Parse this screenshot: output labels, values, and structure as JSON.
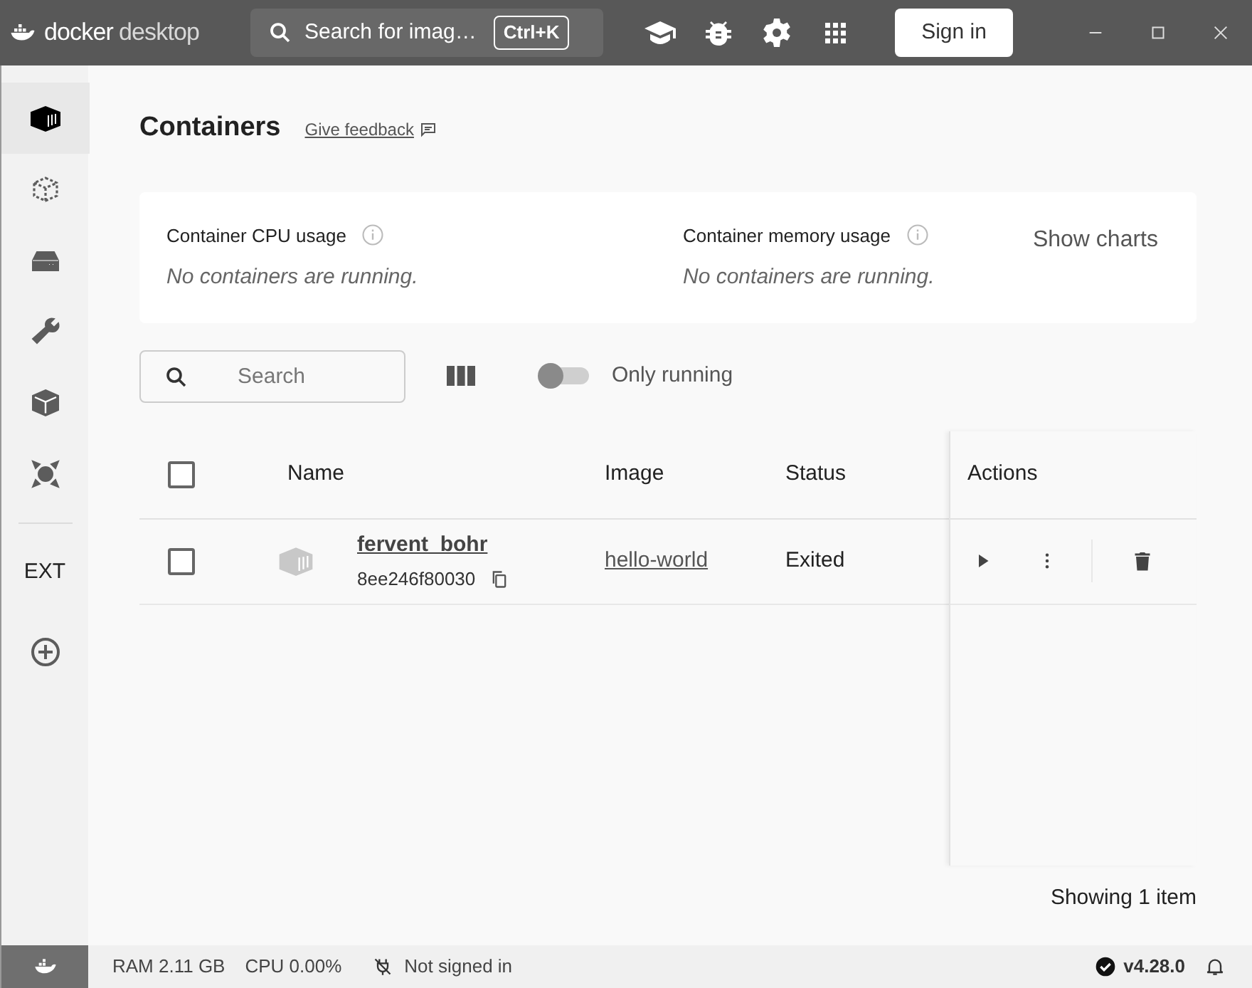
{
  "titlebar": {
    "logo_word": "docker",
    "logo_suffix": "desktop",
    "search_placeholder": "Search for imag…",
    "shortcut": "Ctrl+K",
    "sign_in": "Sign in"
  },
  "sidebar": {
    "items": [
      {
        "kind": "containers",
        "selected": true
      },
      {
        "kind": "images",
        "selected": false
      },
      {
        "kind": "volumes",
        "selected": false
      },
      {
        "kind": "builds",
        "selected": false
      },
      {
        "kind": "devenv",
        "selected": false
      },
      {
        "kind": "scout",
        "selected": false
      },
      {
        "kind": "divider"
      },
      {
        "kind": "text",
        "label": "EXT",
        "selected": false
      },
      {
        "kind": "add",
        "selected": false
      }
    ]
  },
  "page": {
    "title": "Containers",
    "feedback": "Give feedback"
  },
  "stats": [
    {
      "label": "Container CPU usage",
      "message": "No containers are running."
    },
    {
      "label": "Container memory usage",
      "message": "No containers are running."
    }
  ],
  "show_charts": "Show charts",
  "toolbar": {
    "search_placeholder": "Search",
    "only_running": {
      "label": "Only running",
      "on": false
    }
  },
  "table": {
    "columns": [
      "Name",
      "Image",
      "Status",
      "Actions"
    ],
    "rows": [
      {
        "checked": false,
        "name": "fervent_bohr",
        "id": "8ee246f80030",
        "image": "hello-world",
        "status": "Exited"
      }
    ],
    "all_checked": false
  },
  "footer": "Showing 1 item",
  "status_bar": {
    "ram": "RAM 2.11 GB",
    "cpu": "CPU 0.00%",
    "sign_state": "Not signed in",
    "version": "v4.28.0"
  }
}
